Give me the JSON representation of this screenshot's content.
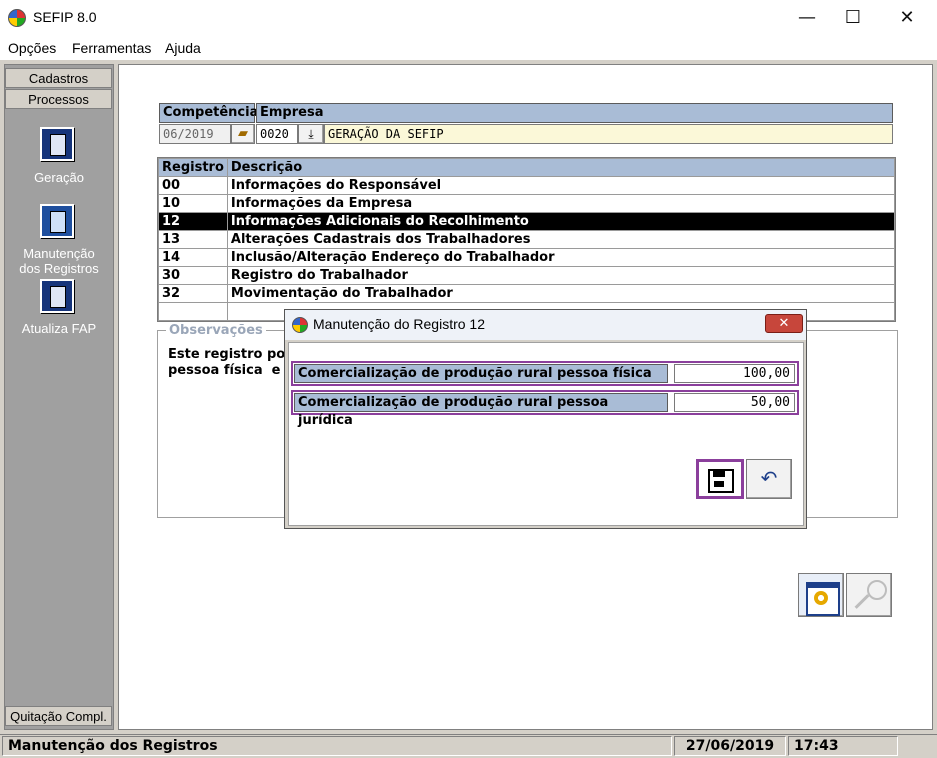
{
  "window": {
    "title": "SEFIP 8.0",
    "minimize": "—",
    "maximize": "☐",
    "close": "✕"
  },
  "menu": [
    "Opções",
    "Ferramentas",
    "Ajuda"
  ],
  "sidebar": {
    "tabs": [
      "Cadastros",
      "Processos"
    ],
    "items": [
      {
        "label_1": "Geração",
        "label_2": ""
      },
      {
        "label_1": "Manutenção",
        "label_2": "dos Registros"
      },
      {
        "label_1": "Atualiza FAP",
        "label_2": ""
      }
    ],
    "bottom_tab": "Quitação Compl."
  },
  "header": {
    "competencia_label": "Competência",
    "empresa_label": "Empresa",
    "competencia_value": "06/2019",
    "empresa_code": "0020",
    "empresa_name": "GERAÇÃO DA SEFIP"
  },
  "registros": {
    "columns": [
      "Registro",
      "Descrição"
    ],
    "rows": [
      {
        "code": "00",
        "desc": "Informações do Responsável"
      },
      {
        "code": "10",
        "desc": "Informações da Empresa"
      },
      {
        "code": "12",
        "desc": "Informações Adicionais do Recolhimento",
        "selected": true
      },
      {
        "code": "13",
        "desc": "Alterações Cadastrais dos Trabalhadores"
      },
      {
        "code": "14",
        "desc": "Inclusão/Alteração Endereço do Trabalhador"
      },
      {
        "code": "30",
        "desc": "Registro do Trabalhador"
      },
      {
        "code": "32",
        "desc": "Movimentação do Trabalhador"
      },
      {
        "code": "",
        "desc": ""
      }
    ]
  },
  "observacoes": {
    "title": "Observações",
    "text": "Este registro poss\npessoa física  e o"
  },
  "dialog": {
    "title": "Manutenção do Registro 12",
    "close": "✕",
    "fields": [
      {
        "label": "Comercialização de produção rural pessoa física",
        "value": "100,00"
      },
      {
        "label": "Comercialização de produção rural pessoa jurídica",
        "value": "50,00"
      }
    ],
    "undo_glyph": "↶"
  },
  "status": {
    "message": "Manutenção dos Registros",
    "date": "27/06/2019",
    "time": "17:43"
  },
  "colors": {
    "header_blue": "#a9bcd6",
    "highlight_purple": "#8b3f9c",
    "selected_row": "#000000",
    "sidebar_gray": "#a0a0a0"
  }
}
